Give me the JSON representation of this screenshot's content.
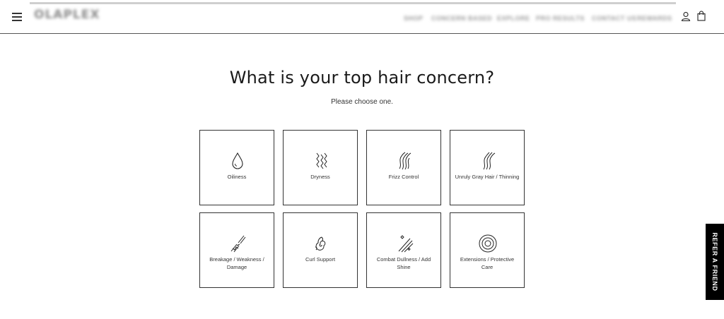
{
  "header": {
    "logo_text": "OLAPLEX",
    "nav": [
      {
        "label": "SHOP"
      },
      {
        "label": "CONCERN BASED"
      },
      {
        "label": "EXPLORE"
      },
      {
        "label": "PRO RESULTS"
      },
      {
        "label": "CONTACT US"
      },
      {
        "label": "REWARDS"
      }
    ],
    "icons": {
      "menu": "hamburger-menu-icon",
      "account": "account-icon",
      "bag": "shopping-bag-icon"
    }
  },
  "quiz": {
    "title": "What is your top hair concern?",
    "subtitle": "Please choose one.",
    "options": [
      {
        "label": "Oiliness",
        "icon": "droplet-icon"
      },
      {
        "label": "Dryness",
        "icon": "dry-hair-icon"
      },
      {
        "label": "Frizz Control",
        "icon": "frizz-hair-icon"
      },
      {
        "label": "Unruly Gray Hair / Thinning",
        "icon": "gray-hair-icon"
      },
      {
        "label": "Breakage / Weakness / Damage",
        "icon": "broken-hair-icon"
      },
      {
        "label": "Curl Support",
        "icon": "curl-icon"
      },
      {
        "label": "Combat Dullness / Add Shine",
        "icon": "shine-icon"
      },
      {
        "label": "Extensions / Protective Care",
        "icon": "target-icon"
      }
    ]
  },
  "refer_tab": {
    "label": "REFER A FRIEND"
  },
  "colors": {
    "border": "#333333",
    "tab_bg": "#000000",
    "tab_text": "#ffffff"
  }
}
